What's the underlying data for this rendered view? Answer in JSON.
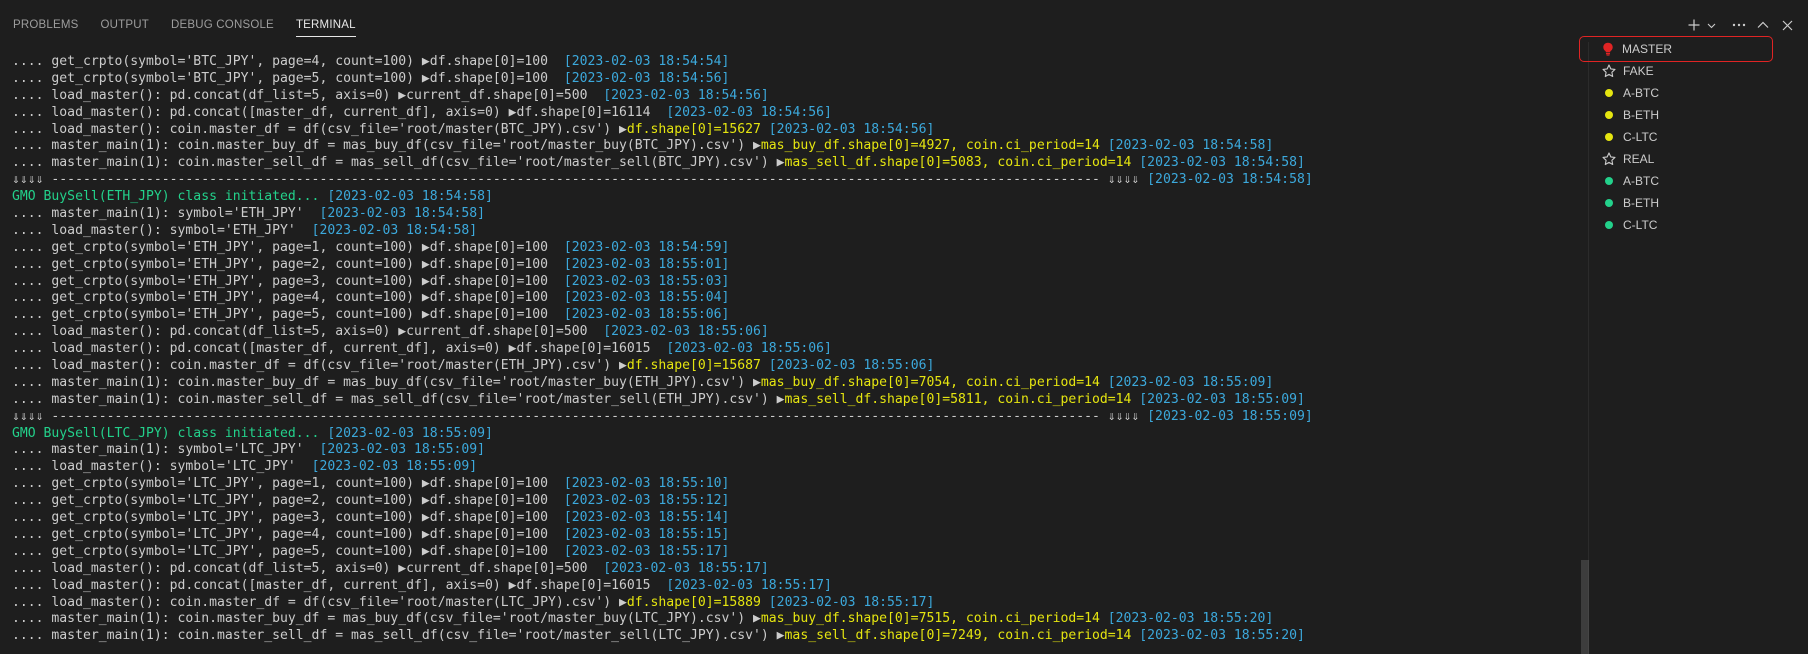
{
  "panel": {
    "tabs": [
      {
        "label": "PROBLEMS"
      },
      {
        "label": "OUTPUT"
      },
      {
        "label": "DEBUG CONSOLE"
      },
      {
        "label": "TERMINAL"
      }
    ],
    "active_tab": "TERMINAL"
  },
  "colors": {
    "timestamp": "#3ca9dc",
    "highlight": "#e5e510",
    "green": "#23d18b",
    "red": "#e02424",
    "yellow": "#e5e510"
  },
  "terminal_lines": [
    [
      {
        "t": ".... get_crpto(symbol='BTC_JPY', page=4, count=100) ▶df.shape[0]=100  "
      },
      {
        "t": "[2023-02-03 18:54:54]",
        "c": "ts"
      }
    ],
    [
      {
        "t": ".... get_crpto(symbol='BTC_JPY', page=5, count=100) ▶df.shape[0]=100  "
      },
      {
        "t": "[2023-02-03 18:54:56]",
        "c": "ts"
      }
    ],
    [
      {
        "t": ".... load_master(): pd.concat(df_list=5, axis=0) ▶current_df.shape[0]=500  "
      },
      {
        "t": "[2023-02-03 18:54:56]",
        "c": "ts"
      }
    ],
    [
      {
        "t": ".... load_master(): pd.concat([master_df, current_df], axis=0) ▶df.shape[0]=16114  "
      },
      {
        "t": "[2023-02-03 18:54:56]",
        "c": "ts"
      }
    ],
    [
      {
        "t": ".... load_master(): coin.master_df = df(csv_file='root/master(BTC_JPY).csv') ▶"
      },
      {
        "t": "df.shape[0]=15627",
        "c": "hl"
      },
      {
        "t": " "
      },
      {
        "t": "[2023-02-03 18:54:56]",
        "c": "ts"
      }
    ],
    [
      {
        "t": ".... master_main(1): coin.master_buy_df = mas_buy_df(csv_file='root/master_buy(BTC_JPY).csv') ▶"
      },
      {
        "t": "mas_buy_df.shape[0]=4927, coin.ci_period=14",
        "c": "hl"
      },
      {
        "t": " "
      },
      {
        "t": "[2023-02-03 18:54:58]",
        "c": "ts"
      }
    ],
    [
      {
        "t": ".... master_main(1): coin.master_sell_df = mas_sell_df(csv_file='root/master_sell(BTC_JPY).csv') ▶"
      },
      {
        "t": "mas_sell_df.shape[0]=5083, coin.ci_period=14",
        "c": "hl"
      },
      {
        "t": " "
      },
      {
        "t": "[2023-02-03 18:54:58]",
        "c": "ts"
      }
    ],
    [
      {
        "t": "⇓⇓⇓⇓ ------------------------------------------------------------------------------------------------------------------------------------- ⇓⇓⇓⇓ "
      },
      {
        "t": "[2023-02-03 18:54:58]",
        "c": "ts"
      }
    ],
    [
      {
        "t": "GMO BuySell(ETH_JPY) class initiated... ",
        "c": "grn"
      },
      {
        "t": "[2023-02-03 18:54:58]",
        "c": "ts"
      }
    ],
    [
      {
        "t": ".... master_main(1): symbol='ETH_JPY'  "
      },
      {
        "t": "[2023-02-03 18:54:58]",
        "c": "ts"
      }
    ],
    [
      {
        "t": ".... load_master(): symbol='ETH_JPY'  "
      },
      {
        "t": "[2023-02-03 18:54:58]",
        "c": "ts"
      }
    ],
    [
      {
        "t": ".... get_crpto(symbol='ETH_JPY', page=1, count=100) ▶df.shape[0]=100  "
      },
      {
        "t": "[2023-02-03 18:54:59]",
        "c": "ts"
      }
    ],
    [
      {
        "t": ".... get_crpto(symbol='ETH_JPY', page=2, count=100) ▶df.shape[0]=100  "
      },
      {
        "t": "[2023-02-03 18:55:01]",
        "c": "ts"
      }
    ],
    [
      {
        "t": ".... get_crpto(symbol='ETH_JPY', page=3, count=100) ▶df.shape[0]=100  "
      },
      {
        "t": "[2023-02-03 18:55:03]",
        "c": "ts"
      }
    ],
    [
      {
        "t": ".... get_crpto(symbol='ETH_JPY', page=4, count=100) ▶df.shape[0]=100  "
      },
      {
        "t": "[2023-02-03 18:55:04]",
        "c": "ts"
      }
    ],
    [
      {
        "t": ".... get_crpto(symbol='ETH_JPY', page=5, count=100) ▶df.shape[0]=100  "
      },
      {
        "t": "[2023-02-03 18:55:06]",
        "c": "ts"
      }
    ],
    [
      {
        "t": ".... load_master(): pd.concat(df_list=5, axis=0) ▶current_df.shape[0]=500  "
      },
      {
        "t": "[2023-02-03 18:55:06]",
        "c": "ts"
      }
    ],
    [
      {
        "t": ".... load_master(): pd.concat([master_df, current_df], axis=0) ▶df.shape[0]=16015  "
      },
      {
        "t": "[2023-02-03 18:55:06]",
        "c": "ts"
      }
    ],
    [
      {
        "t": ".... load_master(): coin.master_df = df(csv_file='root/master(ETH_JPY).csv') ▶"
      },
      {
        "t": "df.shape[0]=15687",
        "c": "hl"
      },
      {
        "t": " "
      },
      {
        "t": "[2023-02-03 18:55:06]",
        "c": "ts"
      }
    ],
    [
      {
        "t": ".... master_main(1): coin.master_buy_df = mas_buy_df(csv_file='root/master_buy(ETH_JPY).csv') ▶"
      },
      {
        "t": "mas_buy_df.shape[0]=7054, coin.ci_period=14",
        "c": "hl"
      },
      {
        "t": " "
      },
      {
        "t": "[2023-02-03 18:55:09]",
        "c": "ts"
      }
    ],
    [
      {
        "t": ".... master_main(1): coin.master_sell_df = mas_sell_df(csv_file='root/master_sell(ETH_JPY).csv') ▶"
      },
      {
        "t": "mas_sell_df.shape[0]=5811, coin.ci_period=14",
        "c": "hl"
      },
      {
        "t": " "
      },
      {
        "t": "[2023-02-03 18:55:09]",
        "c": "ts"
      }
    ],
    [
      {
        "t": "⇓⇓⇓⇓ ------------------------------------------------------------------------------------------------------------------------------------- ⇓⇓⇓⇓ "
      },
      {
        "t": "[2023-02-03 18:55:09]",
        "c": "ts"
      }
    ],
    [
      {
        "t": "GMO BuySell(LTC_JPY) class initiated... ",
        "c": "grn"
      },
      {
        "t": "[2023-02-03 18:55:09]",
        "c": "ts"
      }
    ],
    [
      {
        "t": ".... master_main(1): symbol='LTC_JPY'  "
      },
      {
        "t": "[2023-02-03 18:55:09]",
        "c": "ts"
      }
    ],
    [
      {
        "t": ".... load_master(): symbol='LTC_JPY'  "
      },
      {
        "t": "[2023-02-03 18:55:09]",
        "c": "ts"
      }
    ],
    [
      {
        "t": ".... get_crpto(symbol='LTC_JPY', page=1, count=100) ▶df.shape[0]=100  "
      },
      {
        "t": "[2023-02-03 18:55:10]",
        "c": "ts"
      }
    ],
    [
      {
        "t": ".... get_crpto(symbol='LTC_JPY', page=2, count=100) ▶df.shape[0]=100  "
      },
      {
        "t": "[2023-02-03 18:55:12]",
        "c": "ts"
      }
    ],
    [
      {
        "t": ".... get_crpto(symbol='LTC_JPY', page=3, count=100) ▶df.shape[0]=100  "
      },
      {
        "t": "[2023-02-03 18:55:14]",
        "c": "ts"
      }
    ],
    [
      {
        "t": ".... get_crpto(symbol='LTC_JPY', page=4, count=100) ▶df.shape[0]=100  "
      },
      {
        "t": "[2023-02-03 18:55:15]",
        "c": "ts"
      }
    ],
    [
      {
        "t": ".... get_crpto(symbol='LTC_JPY', page=5, count=100) ▶df.shape[0]=100  "
      },
      {
        "t": "[2023-02-03 18:55:17]",
        "c": "ts"
      }
    ],
    [
      {
        "t": ".... load_master(): pd.concat(df_list=5, axis=0) ▶current_df.shape[0]=500  "
      },
      {
        "t": "[2023-02-03 18:55:17]",
        "c": "ts"
      }
    ],
    [
      {
        "t": ".... load_master(): pd.concat([master_df, current_df], axis=0) ▶df.shape[0]=16015  "
      },
      {
        "t": "[2023-02-03 18:55:17]",
        "c": "ts"
      }
    ],
    [
      {
        "t": ".... load_master(): coin.master_df = df(csv_file='root/master(LTC_JPY).csv') ▶"
      },
      {
        "t": "df.shape[0]=15889",
        "c": "hl"
      },
      {
        "t": " "
      },
      {
        "t": "[2023-02-03 18:55:17]",
        "c": "ts"
      }
    ],
    [
      {
        "t": ".... master_main(1): coin.master_buy_df = mas_buy_df(csv_file='root/master_buy(LTC_JPY).csv') ▶"
      },
      {
        "t": "mas_buy_df.shape[0]=7515, coin.ci_period=14",
        "c": "hl"
      },
      {
        "t": " "
      },
      {
        "t": "[2023-02-03 18:55:20]",
        "c": "ts"
      }
    ],
    [
      {
        "t": ".... master_main(1): coin.master_sell_df = mas_sell_df(csv_file='root/master_sell(LTC_JPY).csv') ▶"
      },
      {
        "t": "mas_sell_df.shape[0]=7249, coin.ci_period=14",
        "c": "hl"
      },
      {
        "t": " "
      },
      {
        "t": "[2023-02-03 18:55:20]",
        "c": "ts"
      }
    ]
  ],
  "terminal_tabs": [
    {
      "label": "MASTER",
      "icon": "lightbulb-icon",
      "icon_color": "#e02424",
      "selected": true
    },
    {
      "label": "FAKE",
      "icon": "star-icon"
    },
    {
      "label": "A-BTC",
      "icon": "dot-icon",
      "icon_color": "#e5e510"
    },
    {
      "label": "B-ETH",
      "icon": "dot-icon",
      "icon_color": "#e5e510"
    },
    {
      "label": "C-LTC",
      "icon": "dot-icon",
      "icon_color": "#e5e510"
    },
    {
      "label": "REAL",
      "icon": "star-icon"
    },
    {
      "label": "A-BTC",
      "icon": "dot-icon",
      "icon_color": "#23d18b"
    },
    {
      "label": "B-ETH",
      "icon": "dot-icon",
      "icon_color": "#23d18b"
    },
    {
      "label": "C-LTC",
      "icon": "dot-icon",
      "icon_color": "#23d18b"
    }
  ],
  "actions": [
    {
      "icon": "plus-icon"
    },
    {
      "icon": "chevron-down-icon"
    },
    {
      "icon": "more-icon"
    },
    {
      "icon": "chevron-up-icon"
    },
    {
      "icon": "close-icon"
    }
  ]
}
